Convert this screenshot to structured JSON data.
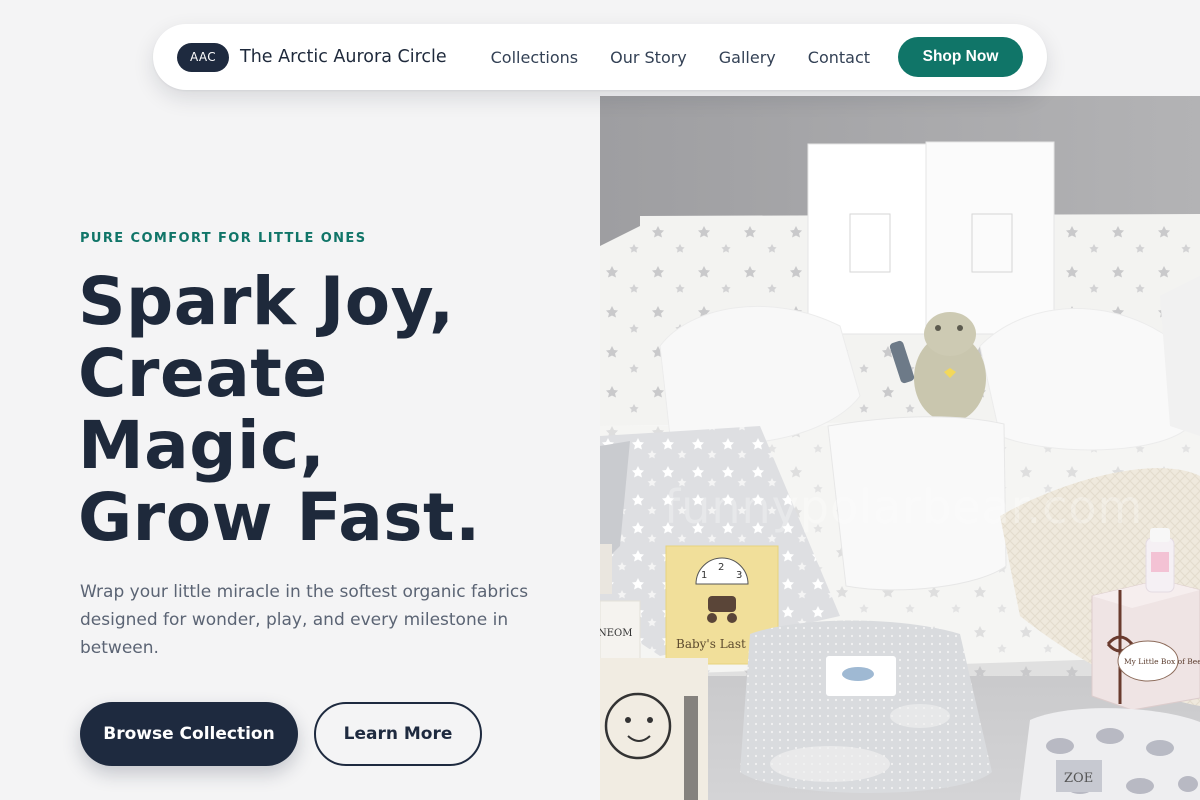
{
  "nav": {
    "badge": "AAC",
    "brand_name": "The Arctic Aurora Circle",
    "links": [
      "Collections",
      "Our Story",
      "Gallery",
      "Contact"
    ],
    "cta": "Shop Now"
  },
  "hero": {
    "eyebrow": "PURE COMFORT FOR LITTLE ONES",
    "headline": [
      "Spark Joy,",
      "Create",
      "Magic,",
      "Grow Fast."
    ],
    "subtext": "Wrap your little miracle in the softest organic fabrics designed for wonder, play, and every milestone in between.",
    "primary_button": "Browse Collection",
    "secondary_button": "Learn More"
  },
  "image": {
    "watermark": "funnypolarbear.com",
    "book_label": "Baby's Last",
    "gauge_numbers": [
      "1",
      "2",
      "3"
    ],
    "tin_label": "My Little Box of Bee Bees",
    "side_label": "NEOM",
    "pack_label": "ZOE"
  },
  "colors": {
    "accent": "#107568",
    "navy": "#1e2a3f",
    "background": "#f4f4f5"
  }
}
